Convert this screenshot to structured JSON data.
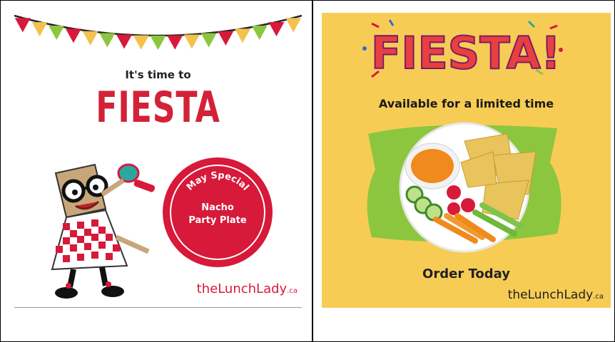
{
  "left_card": {
    "pretitle": "It's time to",
    "title": "FIESTA",
    "badge": {
      "arc_text": "May Special",
      "line1": "Nacho",
      "line2": "Party Plate"
    },
    "brand": "theLunchLady",
    "brand_suffix": ".ca",
    "colors": {
      "red": "#d7193a",
      "background": "#ffffff"
    }
  },
  "right_card": {
    "logo_text": "FIESTA!",
    "subtitle": "Available for a limited time",
    "cta": "Order Today",
    "brand": "theLunchLady",
    "brand_suffix": ".ca",
    "colors": {
      "background": "#f7cc55",
      "green": "#8cc63f"
    }
  }
}
